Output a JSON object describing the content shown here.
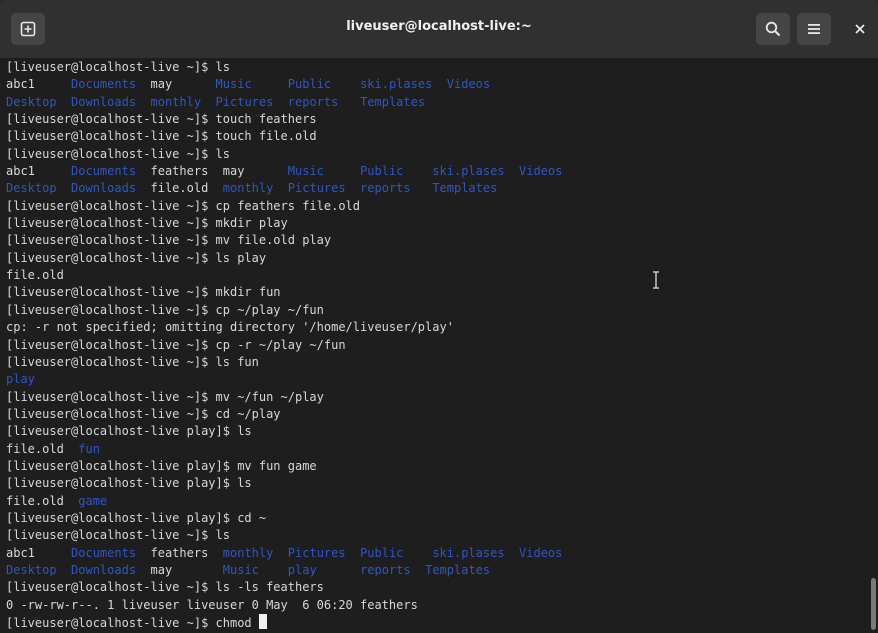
{
  "window": {
    "title": "liveuser@localhost-live:~"
  },
  "icons": {
    "new_tab": "new-tab-icon",
    "search": "search-icon",
    "menu": "hamburger-menu-icon",
    "close": "close-icon"
  },
  "colors": {
    "background": "#1e1e1e",
    "text": "#d8d8d8",
    "directory": "#2f56c4",
    "titlebar": "#303030"
  },
  "terminal": {
    "lines": [
      [
        {
          "t": "[liveuser@localhost-live ~]$ ls"
        }
      ],
      [
        {
          "t": "abc1     "
        },
        {
          "t": "Documents",
          "c": "dir"
        },
        {
          "t": "  may      "
        },
        {
          "t": "Music",
          "c": "dir"
        },
        {
          "t": "     "
        },
        {
          "t": "Public",
          "c": "dir"
        },
        {
          "t": "    "
        },
        {
          "t": "ski.plases",
          "c": "dir"
        },
        {
          "t": "  "
        },
        {
          "t": "Videos",
          "c": "dir"
        }
      ],
      [
        {
          "t": "Desktop",
          "c": "dir"
        },
        {
          "t": "  "
        },
        {
          "t": "Downloads",
          "c": "dir"
        },
        {
          "t": "  "
        },
        {
          "t": "monthly",
          "c": "dir"
        },
        {
          "t": "  "
        },
        {
          "t": "Pictures",
          "c": "dir"
        },
        {
          "t": "  "
        },
        {
          "t": "reports",
          "c": "dir"
        },
        {
          "t": "   "
        },
        {
          "t": "Templates",
          "c": "dir"
        }
      ],
      [
        {
          "t": "[liveuser@localhost-live ~]$ touch feathers"
        }
      ],
      [
        {
          "t": "[liveuser@localhost-live ~]$ touch file.old"
        }
      ],
      [
        {
          "t": "[liveuser@localhost-live ~]$ ls"
        }
      ],
      [
        {
          "t": "abc1     "
        },
        {
          "t": "Documents",
          "c": "dir"
        },
        {
          "t": "  feathers  may      "
        },
        {
          "t": "Music",
          "c": "dir"
        },
        {
          "t": "     "
        },
        {
          "t": "Public",
          "c": "dir"
        },
        {
          "t": "    "
        },
        {
          "t": "ski.plases",
          "c": "dir"
        },
        {
          "t": "  "
        },
        {
          "t": "Videos",
          "c": "dir"
        }
      ],
      [
        {
          "t": "Desktop",
          "c": "dir"
        },
        {
          "t": "  "
        },
        {
          "t": "Downloads",
          "c": "dir"
        },
        {
          "t": "  file.old  "
        },
        {
          "t": "monthly",
          "c": "dir"
        },
        {
          "t": "  "
        },
        {
          "t": "Pictures",
          "c": "dir"
        },
        {
          "t": "  "
        },
        {
          "t": "reports",
          "c": "dir"
        },
        {
          "t": "   "
        },
        {
          "t": "Templates",
          "c": "dir"
        }
      ],
      [
        {
          "t": "[liveuser@localhost-live ~]$ cp feathers file.old"
        }
      ],
      [
        {
          "t": "[liveuser@localhost-live ~]$ mkdir play"
        }
      ],
      [
        {
          "t": "[liveuser@localhost-live ~]$ mv file.old play"
        }
      ],
      [
        {
          "t": "[liveuser@localhost-live ~]$ ls play"
        }
      ],
      [
        {
          "t": "file.old"
        }
      ],
      [
        {
          "t": "[liveuser@localhost-live ~]$ mkdir fun"
        }
      ],
      [
        {
          "t": "[liveuser@localhost-live ~]$ cp ~/play ~/fun"
        }
      ],
      [
        {
          "t": "cp: -r not specified; omitting directory '/home/liveuser/play'"
        }
      ],
      [
        {
          "t": "[liveuser@localhost-live ~]$ cp -r ~/play ~/fun"
        }
      ],
      [
        {
          "t": "[liveuser@localhost-live ~]$ ls fun"
        }
      ],
      [
        {
          "t": "play",
          "c": "dir"
        }
      ],
      [
        {
          "t": "[liveuser@localhost-live ~]$ mv ~/fun ~/play"
        }
      ],
      [
        {
          "t": "[liveuser@localhost-live ~]$ cd ~/play"
        }
      ],
      [
        {
          "t": "[liveuser@localhost-live play]$ ls"
        }
      ],
      [
        {
          "t": "file.old  "
        },
        {
          "t": "fun",
          "c": "dir"
        }
      ],
      [
        {
          "t": "[liveuser@localhost-live play]$ mv fun game"
        }
      ],
      [
        {
          "t": "[liveuser@localhost-live play]$ ls"
        }
      ],
      [
        {
          "t": "file.old  "
        },
        {
          "t": "game",
          "c": "dir"
        }
      ],
      [
        {
          "t": "[liveuser@localhost-live play]$ cd ~"
        }
      ],
      [
        {
          "t": "[liveuser@localhost-live ~]$ ls"
        }
      ],
      [
        {
          "t": "abc1     "
        },
        {
          "t": "Documents",
          "c": "dir"
        },
        {
          "t": "  feathers  "
        },
        {
          "t": "monthly",
          "c": "dir"
        },
        {
          "t": "  "
        },
        {
          "t": "Pictures",
          "c": "dir"
        },
        {
          "t": "  "
        },
        {
          "t": "Public",
          "c": "dir"
        },
        {
          "t": "    "
        },
        {
          "t": "ski.plases",
          "c": "dir"
        },
        {
          "t": "  "
        },
        {
          "t": "Videos",
          "c": "dir"
        }
      ],
      [
        {
          "t": "Desktop",
          "c": "dir"
        },
        {
          "t": "  "
        },
        {
          "t": "Downloads",
          "c": "dir"
        },
        {
          "t": "  may       "
        },
        {
          "t": "Music",
          "c": "dir"
        },
        {
          "t": "    "
        },
        {
          "t": "play",
          "c": "dir"
        },
        {
          "t": "      "
        },
        {
          "t": "reports",
          "c": "dir"
        },
        {
          "t": "  "
        },
        {
          "t": "Templates",
          "c": "dir"
        }
      ],
      [
        {
          "t": "[liveuser@localhost-live ~]$ ls -ls feathers"
        }
      ],
      [
        {
          "t": "0 -rw-rw-r--. 1 liveuser liveuser 0 May  6 06:20 feathers"
        }
      ],
      [
        {
          "t": "[liveuser@localhost-live ~]$ chmod "
        }
      ]
    ]
  }
}
